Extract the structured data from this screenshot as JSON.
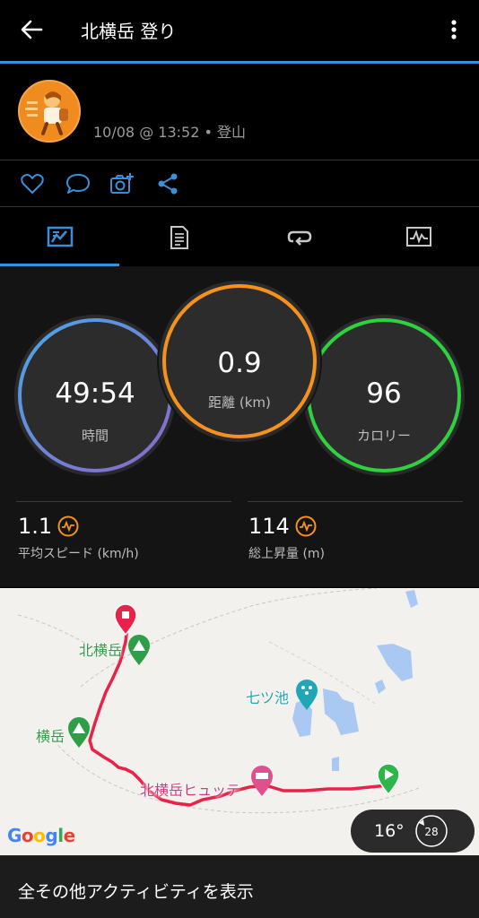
{
  "topbar": {
    "title": "北横岳 登り"
  },
  "activity": {
    "meta": "10/08 @ 13:52 • 登山"
  },
  "actions": [
    "like",
    "comment",
    "add-photo",
    "share"
  ],
  "tabs": [
    "overview",
    "details",
    "laps",
    "charts"
  ],
  "rings": {
    "time": {
      "value": "49:54",
      "label": "時間"
    },
    "distance": {
      "value": "0.9",
      "label": "距離 (km)"
    },
    "calories": {
      "value": "96",
      "label": "カロリー"
    }
  },
  "metrics": {
    "avg_speed": {
      "value": "1.1",
      "label": "平均スピード (km/h)"
    },
    "ascent": {
      "value": "114",
      "label": "総上昇量 (m)"
    }
  },
  "map": {
    "labels": {
      "kitayokodake": "北横岳",
      "yokodake": "横岳",
      "nanatsuike": "七ツ池",
      "hutte": "北横岳ヒュッテ"
    },
    "attribution": "Google",
    "weather": {
      "temp": "16°",
      "wind": "28"
    }
  },
  "footer": {
    "label": "全その他アクティビティを表示"
  },
  "colors": {
    "accent": "#3a8fd6",
    "time_ring": "#5c8fe0",
    "distance_ring": "#f5921e",
    "calories_ring": "#2ed13e",
    "route": "#e8234a",
    "peak": "#2e9e48",
    "lake": "#a9c8f2"
  }
}
